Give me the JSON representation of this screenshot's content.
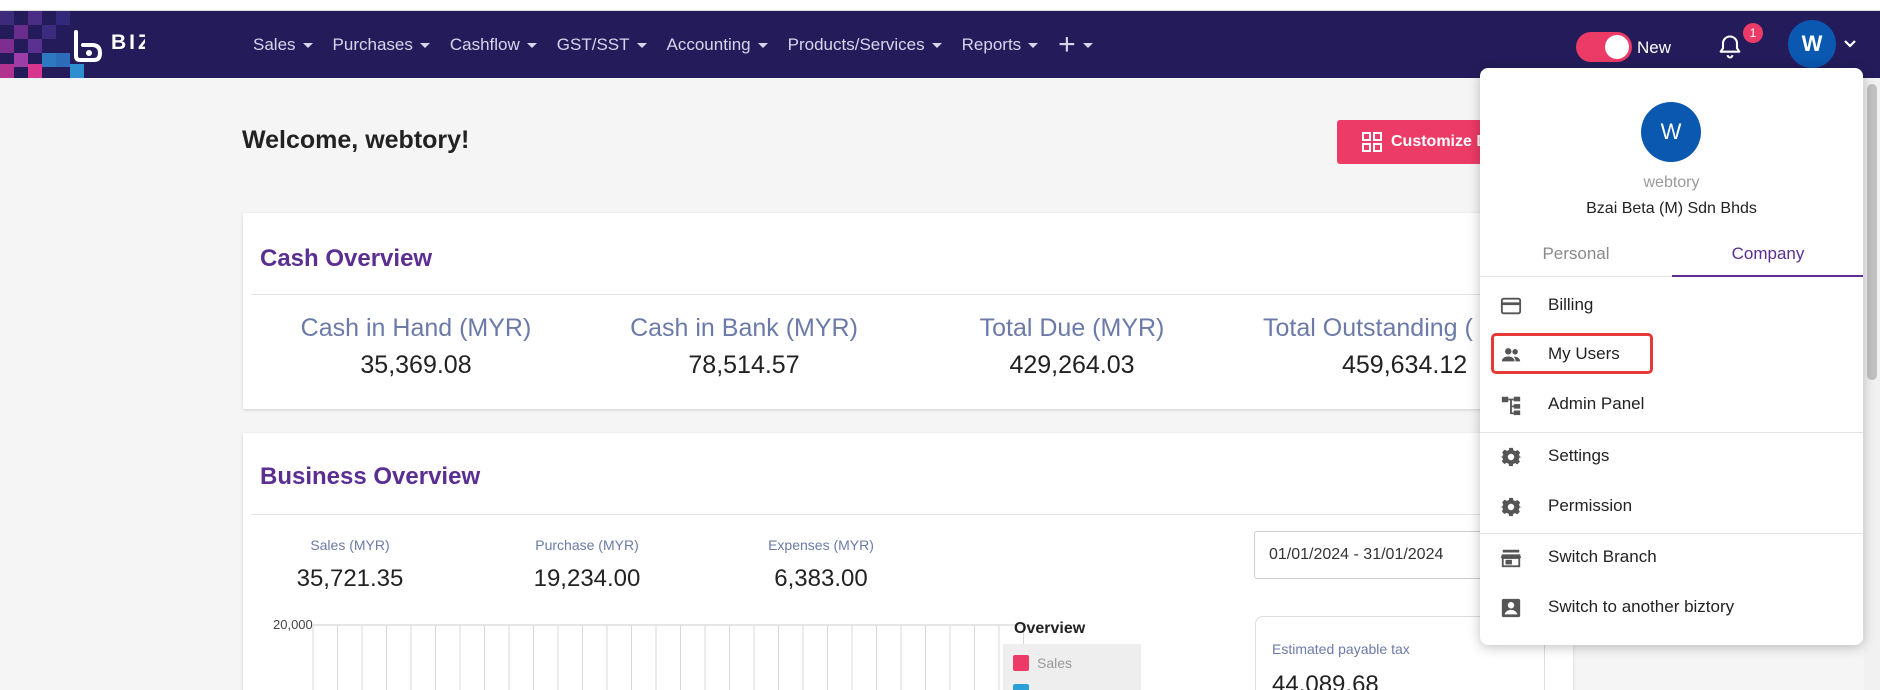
{
  "nav": {
    "logo": "BIZTORY",
    "menu": [
      {
        "label": "Sales"
      },
      {
        "label": "Purchases"
      },
      {
        "label": "Cashflow"
      },
      {
        "label": "GST/SST"
      },
      {
        "label": "Accounting"
      },
      {
        "label": "Products/Services"
      },
      {
        "label": "Reports"
      }
    ],
    "plus": "+",
    "toggle_label": "New",
    "notification_count": "1",
    "avatar_initial": "W"
  },
  "page": {
    "welcome": "Welcome, webtory!",
    "customize_label": "Customize D"
  },
  "cash_overview": {
    "title": "Cash Overview",
    "stats": [
      {
        "label": "Cash in Hand (MYR)",
        "value": "35,369.08"
      },
      {
        "label": "Cash in Bank (MYR)",
        "value": "78,514.57"
      },
      {
        "label": "Total Due (MYR)",
        "value": "429,264.03"
      },
      {
        "label": "Total Outstanding (",
        "value": "459,634.12"
      }
    ]
  },
  "business_overview": {
    "title": "Business Overview",
    "stats": [
      {
        "label": "Sales (MYR)",
        "value": "35,721.35"
      },
      {
        "label": "Purchase (MYR)",
        "value": "19,234.00"
      },
      {
        "label": "Expenses (MYR)",
        "value": "6,383.00"
      }
    ],
    "date_range": "01/01/2024 - 31/01/2024",
    "chart_y_tick": "20,000",
    "legend_title": "Overview",
    "legend_items": [
      "Sales"
    ],
    "tax_label": "Estimated payable tax",
    "tax_value": "44,089.68"
  },
  "dropdown": {
    "avatar_initial": "W",
    "username": "webtory",
    "company": "Bzai Beta (M) Sdn Bhds",
    "tabs": [
      "Personal",
      "Company"
    ],
    "items": [
      {
        "label": "Billing",
        "icon": "credit-card-icon"
      },
      {
        "label": "My Users",
        "icon": "users-icon"
      },
      {
        "label": "Admin Panel",
        "icon": "hierarchy-icon"
      },
      {
        "label": "Settings",
        "icon": "gear-icon"
      },
      {
        "label": "Permission",
        "icon": "gear-icon"
      },
      {
        "label": "Switch Branch",
        "icon": "store-icon"
      },
      {
        "label": "Switch to another biztory",
        "icon": "account-box-icon"
      }
    ]
  },
  "colors": {
    "navbar": "#241c5a",
    "accent_pink": "#ec3b66",
    "title_purple": "#5b2e91",
    "avatar_blue": "#0b58b0",
    "highlight_red": "#e53935"
  }
}
